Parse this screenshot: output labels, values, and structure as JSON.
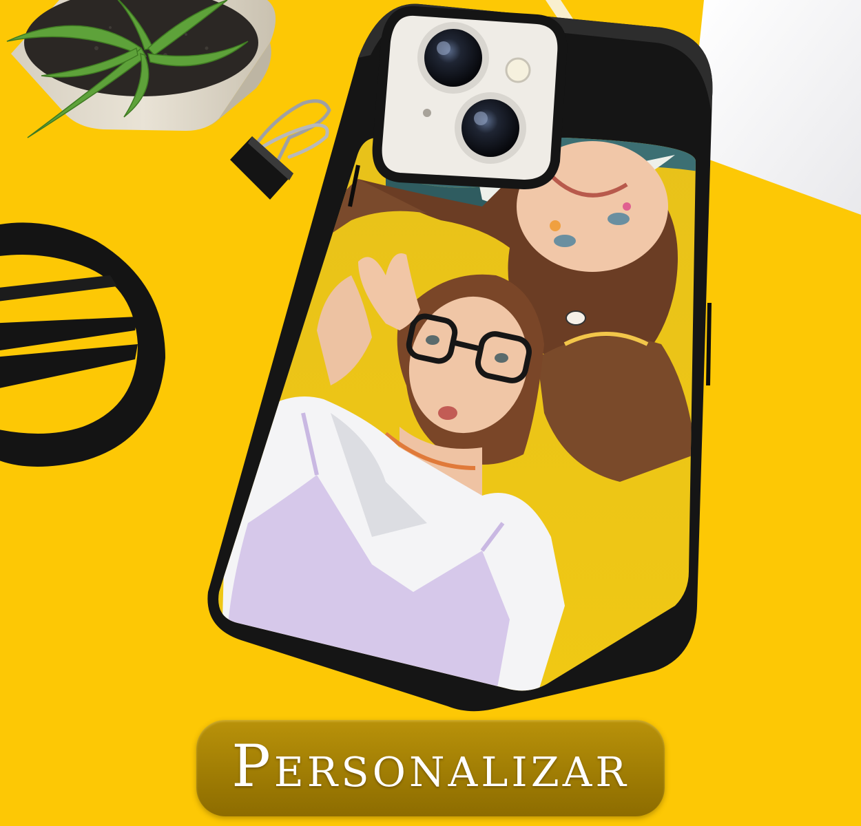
{
  "cta": {
    "label": "Personalizar"
  },
  "colors": {
    "background": "#fdc805",
    "button": "#a07d04",
    "case_frame": "#151515",
    "case_back": "#efece6"
  },
  "icons": [
    "plant-pot-icon",
    "binder-clip-icon",
    "black-stand-icon",
    "camera-lens-icon",
    "flash-icon"
  ]
}
